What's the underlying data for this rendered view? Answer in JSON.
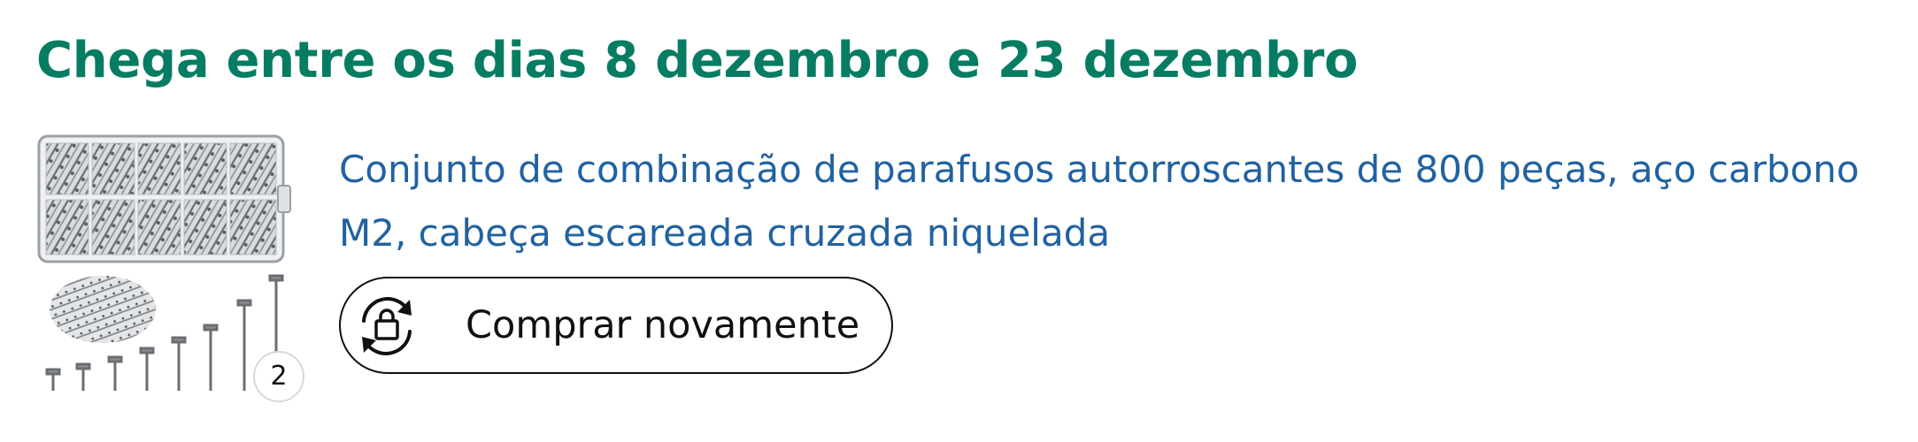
{
  "delivery": {
    "title": "Chega entre os dias 8 dezembro e 23 dezembro"
  },
  "product": {
    "title": "Conjunto de combinação de parafusos autorroscantes de 800 peças, aço carbono M2, cabeça escareada cruzada niquelada",
    "quantity": "2",
    "image_icon": "screw-kit-image"
  },
  "actions": {
    "buy_again_label": "Comprar novamente",
    "buy_again_icon": "buy-again-icon"
  },
  "colors": {
    "delivery_text": "#067d62",
    "link_text": "#2162a1",
    "button_border": "#0f1111"
  }
}
